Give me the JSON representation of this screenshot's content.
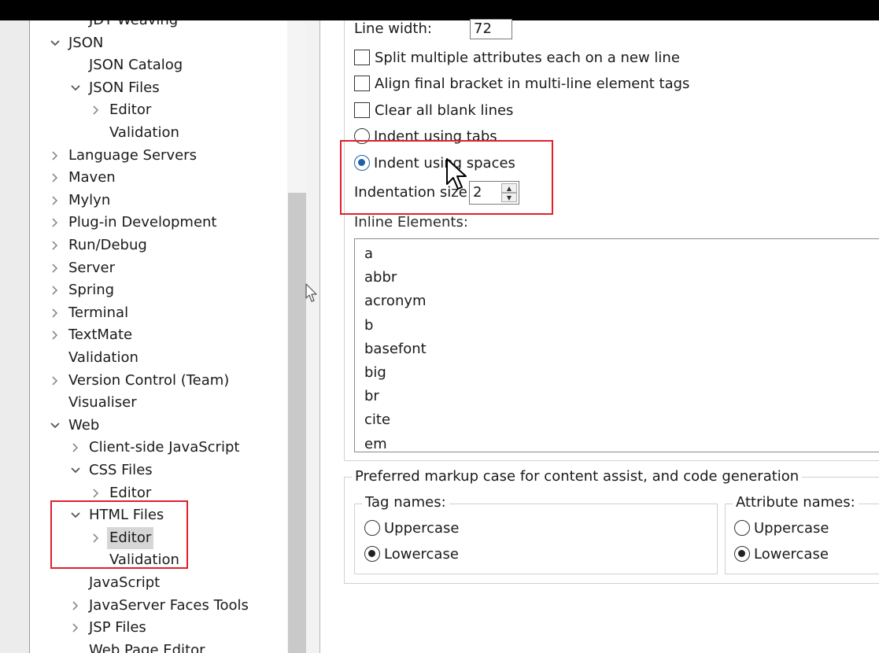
{
  "tree": {
    "items": [
      {
        "label": "JDT Weaving",
        "level": 1,
        "chevron": "none"
      },
      {
        "label": "JSON",
        "level": 0,
        "chevron": "expanded"
      },
      {
        "label": "JSON Catalog",
        "level": 1,
        "chevron": "none"
      },
      {
        "label": "JSON Files",
        "level": 1,
        "chevron": "expanded"
      },
      {
        "label": "Editor",
        "level": 2,
        "chevron": "collapsed"
      },
      {
        "label": "Validation",
        "level": 2,
        "chevron": "none"
      },
      {
        "label": "Language Servers",
        "level": 0,
        "chevron": "collapsed"
      },
      {
        "label": "Maven",
        "level": 0,
        "chevron": "collapsed"
      },
      {
        "label": "Mylyn",
        "level": 0,
        "chevron": "collapsed"
      },
      {
        "label": "Plug-in Development",
        "level": 0,
        "chevron": "collapsed"
      },
      {
        "label": "Run/Debug",
        "level": 0,
        "chevron": "collapsed"
      },
      {
        "label": "Server",
        "level": 0,
        "chevron": "collapsed"
      },
      {
        "label": "Spring",
        "level": 0,
        "chevron": "collapsed"
      },
      {
        "label": "Terminal",
        "level": 0,
        "chevron": "collapsed"
      },
      {
        "label": "TextMate",
        "level": 0,
        "chevron": "collapsed"
      },
      {
        "label": "Validation",
        "level": 0,
        "chevron": "none"
      },
      {
        "label": "Version Control (Team)",
        "level": 0,
        "chevron": "collapsed"
      },
      {
        "label": "Visualiser",
        "level": 0,
        "chevron": "none"
      },
      {
        "label": "Web",
        "level": 0,
        "chevron": "expanded"
      },
      {
        "label": "Client-side JavaScript",
        "level": 1,
        "chevron": "collapsed"
      },
      {
        "label": "CSS Files",
        "level": 1,
        "chevron": "expanded"
      },
      {
        "label": "Editor",
        "level": 2,
        "chevron": "collapsed"
      },
      {
        "label": "HTML Files",
        "level": 1,
        "chevron": "expanded"
      },
      {
        "label": "Editor",
        "level": 2,
        "chevron": "collapsed",
        "selected": true
      },
      {
        "label": "Validation",
        "level": 2,
        "chevron": "none"
      },
      {
        "label": "JavaScript",
        "level": 1,
        "chevron": "none"
      },
      {
        "label": "JavaServer Faces Tools",
        "level": 1,
        "chevron": "collapsed"
      },
      {
        "label": "JSP Files",
        "level": 1,
        "chevron": "collapsed"
      },
      {
        "label": "Web Page Editor",
        "level": 1,
        "chevron": "none"
      }
    ]
  },
  "formatting": {
    "line_width_label": "Line width:",
    "line_width_value": "72",
    "split_attributes_label": "Split multiple attributes each on a new line",
    "split_attributes_checked": false,
    "align_bracket_label": "Align final bracket in multi-line element tags",
    "align_bracket_checked": false,
    "clear_blank_label": "Clear all blank lines",
    "clear_blank_checked": false,
    "indent_tabs_label": "Indent using tabs",
    "indent_spaces_label": "Indent using spaces",
    "indent_mode": "spaces",
    "indent_size_label": "Indentation size:",
    "indent_size_value": "2",
    "inline_elements_label": "Inline Elements:",
    "inline_elements": [
      "a",
      "abbr",
      "acronym",
      "b",
      "basefont",
      "big",
      "br",
      "cite",
      "em"
    ]
  },
  "markup_case": {
    "group_title": "Preferred markup case for content assist, and code generation",
    "tag_names": {
      "title": "Tag names:",
      "uppercase": "Uppercase",
      "lowercase": "Lowercase",
      "selected": "lowercase"
    },
    "attribute_names": {
      "title": "Attribute names:",
      "uppercase": "Uppercase",
      "lowercase": "Lowercase",
      "selected": "lowercase"
    }
  },
  "colors": {
    "highlight": "#e0202a",
    "selected_radio": "#1e5fa8",
    "selection_bg": "#d6d6d6"
  }
}
